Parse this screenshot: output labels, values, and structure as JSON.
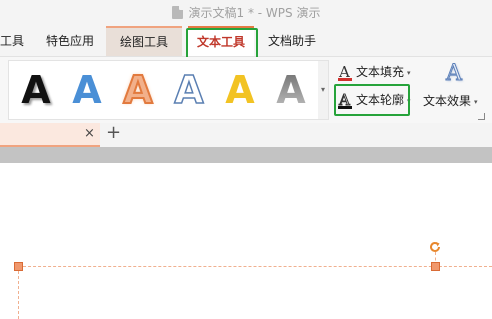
{
  "title_bar": {
    "title": "演示文稿1 * - WPS 演示"
  },
  "tabs": [
    {
      "label": "工具"
    },
    {
      "label": "特色应用"
    },
    {
      "label": "绘图工具"
    },
    {
      "label": "文本工具"
    },
    {
      "label": "文档助手"
    }
  ],
  "gallery": {
    "letters": [
      "A",
      "A",
      "A",
      "A",
      "A",
      "A"
    ],
    "more": "▾"
  },
  "ribbon": {
    "text_fill": "文本填充",
    "text_outline": "文本轮廓",
    "text_effect": "文本效果",
    "effect_glyph": "A",
    "caret": "▾"
  },
  "doc_tabs": {
    "close": "×",
    "new": "+"
  },
  "colors": {
    "accent": "#e47a44",
    "highlight_box": "#26a33a",
    "fill_underline": "#d0312d"
  }
}
